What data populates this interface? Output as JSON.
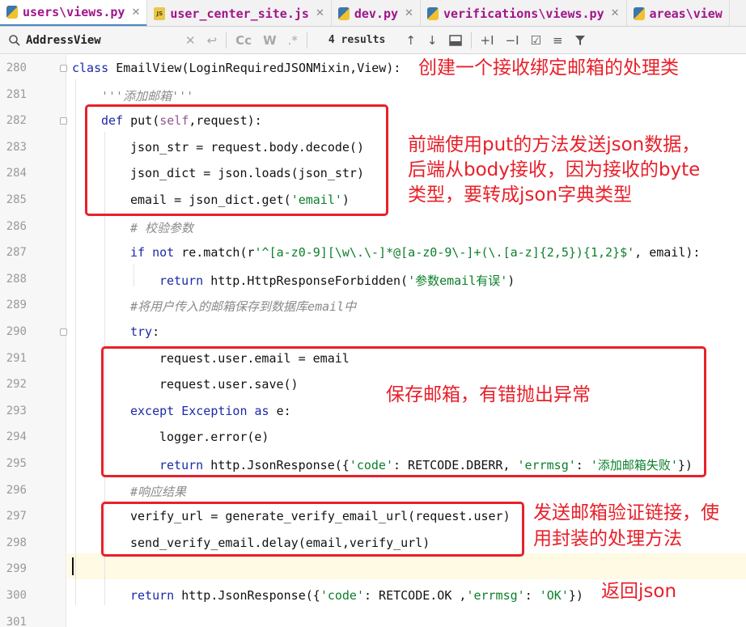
{
  "tabs": [
    {
      "label": "users\\views.py",
      "icon": "python-file-icon",
      "active": true
    },
    {
      "label": "user_center_site.js",
      "icon": "js-file-icon",
      "active": false
    },
    {
      "label": "dev.py",
      "icon": "python-file-icon",
      "active": false
    },
    {
      "label": "verifications\\views.py",
      "icon": "python-file-icon",
      "active": false
    },
    {
      "label": "areas\\view",
      "icon": "python-file-icon",
      "active": false
    }
  ],
  "search": {
    "value": "AddressView",
    "results": "4 results"
  },
  "lines": [
    {
      "n": "280"
    },
    {
      "n": "281"
    },
    {
      "n": "282"
    },
    {
      "n": "283"
    },
    {
      "n": "284"
    },
    {
      "n": "285"
    },
    {
      "n": "286"
    },
    {
      "n": "287"
    },
    {
      "n": "288"
    },
    {
      "n": "289"
    },
    {
      "n": "290"
    },
    {
      "n": "291"
    },
    {
      "n": "292"
    },
    {
      "n": "293"
    },
    {
      "n": "294"
    },
    {
      "n": "295"
    },
    {
      "n": "296"
    },
    {
      "n": "297"
    },
    {
      "n": "298"
    },
    {
      "n": "299"
    },
    {
      "n": "300"
    },
    {
      "n": "301"
    }
  ],
  "code": {
    "l280_kw": "class ",
    "l280_rest": "EmailView(LoginRequiredJSONMixin,View):",
    "l281": "'''添加邮箱'''",
    "l282_kw": "def ",
    "l282_fn": "put(",
    "l282_self": "self",
    "l282_rest": ",request):",
    "l283": "json_str = request.body.decode()",
    "l284": "json_dict = json.loads(json_str)",
    "l285_a": "email = json_dict.get(",
    "l285_s": "'email'",
    "l285_b": ")",
    "l286": "# 校验参数",
    "l287_kw1": "if not ",
    "l287_a": "re.match(r",
    "l287_re": "'^[a-z0-9][\\w\\.\\-]*@[a-z0-9\\-]+(\\.[a-z]{2,5}){1,2}$'",
    "l287_b": ", email):",
    "l288_kw": "return ",
    "l288_a": "http.HttpResponseForbidden(",
    "l288_s": "'参数email有误'",
    "l288_b": ")",
    "l289": "#将用户传入的邮箱保存到数据库email中",
    "l290_kw": "try",
    "l290_b": ":",
    "l291": "request.user.email = email",
    "l292": "request.user.save()",
    "l293_kw": "except ",
    "l293_a": "Exception ",
    "l293_kw2": "as ",
    "l293_b": "e:",
    "l294": "logger.error(e)",
    "l295_kw": "return ",
    "l295_a": "http.JsonResponse({",
    "l295_s1": "'code'",
    "l295_b": ": RETCODE.DBERR, ",
    "l295_s2": "'errmsg'",
    "l295_c": ": ",
    "l295_s3": "'添加邮箱失败'",
    "l295_d": "})",
    "l296": "#响应结果",
    "l297": "verify_url = generate_verify_email_url(request.user)",
    "l298": "send_verify_email.delay(email,verify_url)",
    "l300_kw": "return ",
    "l300_a": "http.JsonResponse({",
    "l300_s1": "'code'",
    "l300_b": ": RETCODE.OK ,",
    "l300_s2": "'errmsg'",
    "l300_c": ": ",
    "l300_s3": "'OK'",
    "l300_d": "})"
  },
  "annotations": {
    "class_note": "创建一个接收绑定邮箱的处理类",
    "put_note_1": "前端使用put的方法发送json数据，",
    "put_note_2": "后端从body接收，因为接收的byte",
    "put_note_3": "类型，要转成json字典类型",
    "save_note": "保存邮箱，有错抛出异常",
    "verify_note_1": "发送邮箱验证链接，使",
    "verify_note_2": "用封装的处理方法",
    "return_note": "返回json"
  },
  "colors": {
    "annotation": "#e8202a",
    "keyword": "#1b2aa6",
    "string": "#0b7f2a",
    "tab_label": "#a0158a"
  }
}
